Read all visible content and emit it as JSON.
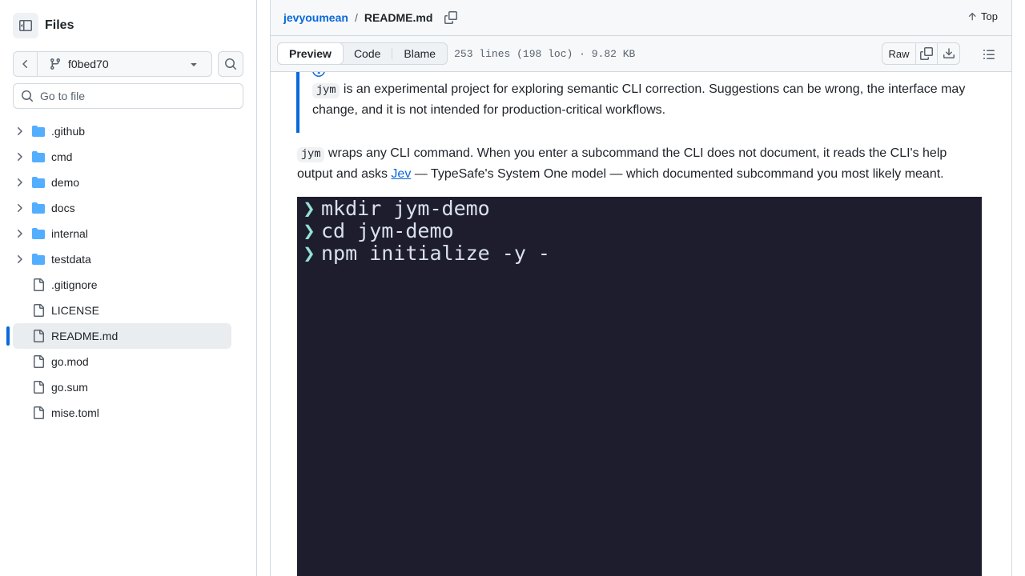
{
  "sidebar": {
    "title": "Files",
    "branch": "f0bed70",
    "goto_placeholder": "Go to file",
    "items": [
      {
        "label": ".github",
        "type": "folder"
      },
      {
        "label": "cmd",
        "type": "folder"
      },
      {
        "label": "demo",
        "type": "folder"
      },
      {
        "label": "docs",
        "type": "folder"
      },
      {
        "label": "internal",
        "type": "folder"
      },
      {
        "label": "testdata",
        "type": "folder"
      },
      {
        "label": ".gitignore",
        "type": "file"
      },
      {
        "label": "LICENSE",
        "type": "file"
      },
      {
        "label": "README.md",
        "type": "file",
        "active": true
      },
      {
        "label": "go.mod",
        "type": "file"
      },
      {
        "label": "go.sum",
        "type": "file"
      },
      {
        "label": "mise.toml",
        "type": "file"
      }
    ]
  },
  "header": {
    "repo": "jevyoumean",
    "separator": "/",
    "file": "README.md",
    "top_label": "Top"
  },
  "filebar": {
    "tabs": [
      "Preview",
      "Code",
      "Blame"
    ],
    "active_tab": "Preview",
    "meta": "253 lines (198 loc) · 9.82 KB",
    "raw_label": "Raw"
  },
  "content": {
    "callout_code": "jym",
    "callout_text": " is an experimental project for exploring semantic CLI correction. Suggestions can be wrong, the interface may change, and it is not intended for production-critical workflows.",
    "para_code": "jym",
    "para_text_1": " wraps any CLI command. When you enter a subcommand the CLI does not document, it reads the CLI's help output and asks ",
    "para_link": "Jev",
    "para_text_2": " — TypeSafe's System One model — which documented subcommand you most likely meant.",
    "terminal": {
      "prompt": "❯",
      "lines": [
        "mkdir jym-demo",
        "cd jym-demo",
        "npm initialize -y -"
      ]
    }
  },
  "colors": {
    "accent": "#0969da",
    "folder": "#54aeff",
    "terminal_bg": "#1e1d2d",
    "terminal_prompt": "#94e2d5"
  }
}
